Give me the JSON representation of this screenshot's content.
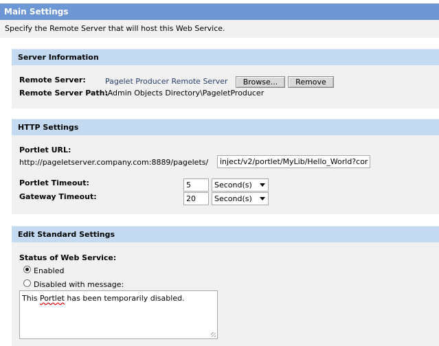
{
  "main": {
    "title": "Main Settings",
    "description": "Specify the Remote Server that will host this Web Service."
  },
  "server_info": {
    "title": "Server Information",
    "remote_server_label": "Remote Server:",
    "remote_server_value": "Pagelet Producer Remote Server",
    "browse_label": "Browse...",
    "remove_label": "Remove",
    "path_label": "Remote Server Path:",
    "path_value": "\\Admin Objects Directory\\PageletProducer"
  },
  "http": {
    "title": "HTTP Settings",
    "portlet_url_label": "Portlet URL:",
    "url_prefix": "http://pageletserver.company.com:8889/pagelets/",
    "url_value": "inject/v2/portlet/MyLib/Hello_World?cor",
    "portlet_timeout_label": "Portlet Timeout:",
    "portlet_timeout_value": "5",
    "portlet_timeout_unit": "Second(s)",
    "gateway_timeout_label": "Gateway Timeout:",
    "gateway_timeout_value": "20",
    "gateway_timeout_unit": "Second(s)"
  },
  "standard": {
    "title": "Edit Standard Settings",
    "status_label": "Status of Web Service:",
    "enabled_label": "Enabled",
    "disabled_label": "Disabled with message:",
    "message_before": "This ",
    "message_word": "Portlet",
    "message_after": " has been temporarily disabled."
  }
}
